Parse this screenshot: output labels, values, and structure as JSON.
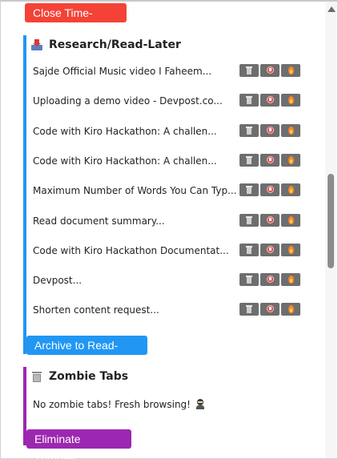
{
  "close_button": {
    "label": "Close Time-Sinks"
  },
  "research": {
    "title": "Research/Read-Later",
    "icon": "inbox-tray-icon",
    "items": [
      {
        "title": "Sajde Official Music video I Faheem..."
      },
      {
        "title": "Uploading a demo video - Devpost.co..."
      },
      {
        "title": "Code with Kiro Hackathon: A challen..."
      },
      {
        "title": "Code with Kiro Hackathon: A challen..."
      },
      {
        "title": "Maximum Number of Words You Can Typ..."
      },
      {
        "title": "Read document summary..."
      },
      {
        "title": "Code with Kiro Hackathon Documentat..."
      },
      {
        "title": "Devpost..."
      },
      {
        "title": "Shorten content request..."
      }
    ],
    "action_icons": [
      "trash-icon",
      "alarm-clock-icon",
      "fire-icon"
    ],
    "archive_button": {
      "label": "Archive to Read-Later"
    }
  },
  "zombie": {
    "title": "Zombie Tabs",
    "icon": "wastebasket-icon",
    "message": "No zombie tabs! Fresh browsing!",
    "message_icon": "ninja-icon",
    "eliminate_button": {
      "label": "Eliminate Zombies"
    }
  },
  "colors": {
    "close_red": "#f44336",
    "research_blue": "#2196f3",
    "zombie_purple": "#9c27b0",
    "action_gray": "#6e6e6e"
  }
}
